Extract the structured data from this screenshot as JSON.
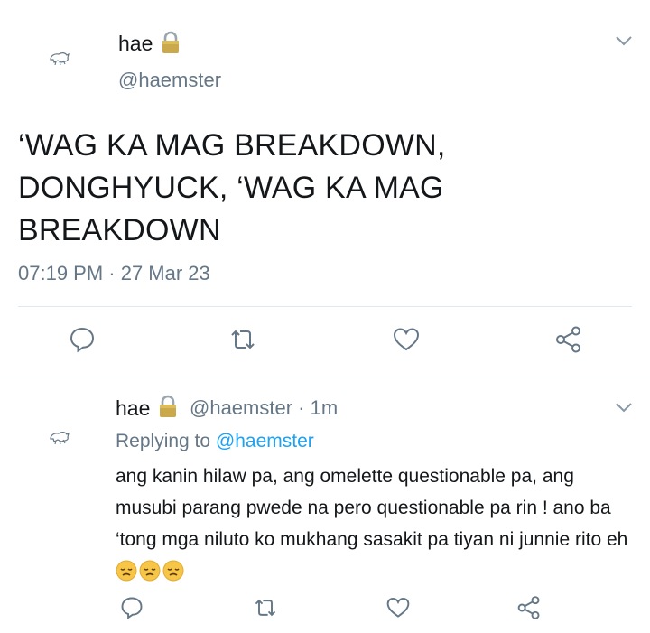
{
  "tweet": {
    "display_name": "hae",
    "handle": "@haemster",
    "text": "‘WAG KA MAG BREAKDOWN, DONGHYUCK, ‘WAG KA MAG BREAKDOWN",
    "timestamp": "07:19 PM · 27 Mar 23"
  },
  "reply": {
    "display_name": "hae",
    "handle_time": "@haemster · 1m",
    "replying_label": "Replying to",
    "replying_handle": "@haemster",
    "text": "ang kanin hilaw pa, ang omelette questionable pa, ang musubi parang pwede na pero questionable pa rin ! ano ba ‘tong mga niluto ko mukhang sasakit pa tiyan ni junnie rito eh",
    "emojis": [
      "disappointed-face",
      "disappointed-face",
      "disappointed-face"
    ]
  },
  "colors": {
    "accent": "#1da1f2",
    "secondary_text": "#657786",
    "divider": "#e1e8ed",
    "icon": "#657786"
  },
  "icons": [
    "avatar",
    "lock-icon",
    "chevron-down-icon",
    "reply-icon",
    "retweet-icon",
    "like-icon",
    "share-icon"
  ]
}
